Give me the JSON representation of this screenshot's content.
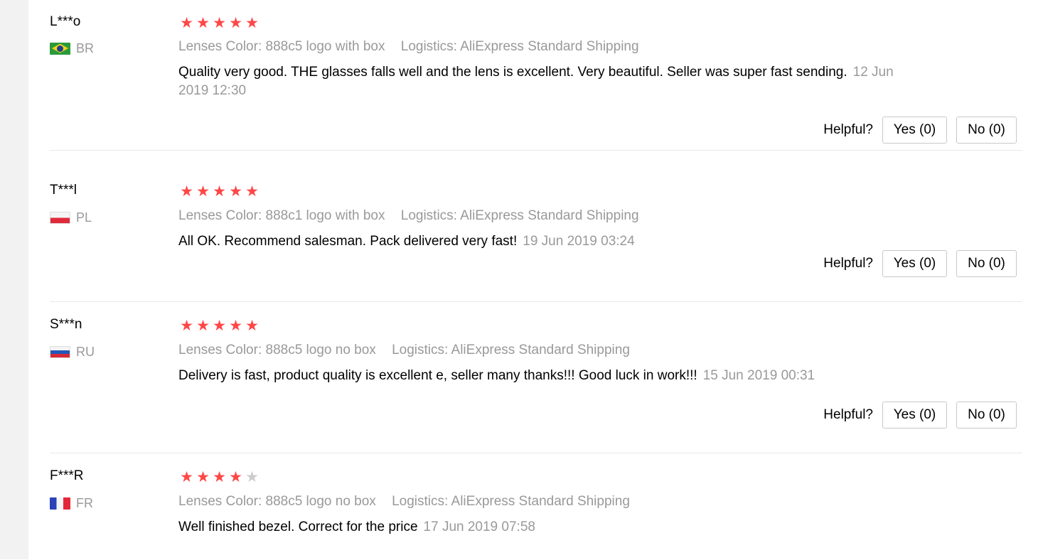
{
  "helpful_label": "Helpful?",
  "reviews": [
    {
      "buyer": "L***o",
      "country": "BR",
      "rating": 5,
      "lenses_color": "Lenses Color: 888c5 logo with box",
      "logistics": "Logistics: AliExpress Standard Shipping",
      "text": "Quality very good. THE glasses falls well and the lens is excellent. Very beautiful. Seller was super fast sending.",
      "date": "12 Jun 2019 12:30",
      "yes": "Yes (0)",
      "no": "No (0)"
    },
    {
      "buyer": "T***l",
      "country": "PL",
      "rating": 5,
      "lenses_color": "Lenses Color: 888c1 logo with box",
      "logistics": "Logistics: AliExpress Standard Shipping",
      "text": "All OK. Recommend salesman. Pack delivered very fast!",
      "date": "19 Jun 2019 03:24",
      "yes": "Yes (0)",
      "no": "No (0)"
    },
    {
      "buyer": "S***n",
      "country": "RU",
      "rating": 5,
      "lenses_color": "Lenses Color: 888c5 logo no box",
      "logistics": "Logistics: AliExpress Standard Shipping",
      "text": "Delivery is fast, product quality is excellent e, seller many thanks!!! Good luck in work!!!",
      "date": "15 Jun 2019 00:31",
      "yes": "Yes (0)",
      "no": "No (0)"
    },
    {
      "buyer": "F***R",
      "country": "FR",
      "rating": 4,
      "lenses_color": "Lenses Color: 888c5 logo no box",
      "logistics": "Logistics: AliExpress Standard Shipping",
      "text": "Well finished bezel. Correct for the price",
      "date": "17 Jun 2019 07:58"
    }
  ],
  "colors": {
    "star_on": "#ff4747",
    "star_off": "#cccccc",
    "muted_text": "#999999"
  }
}
